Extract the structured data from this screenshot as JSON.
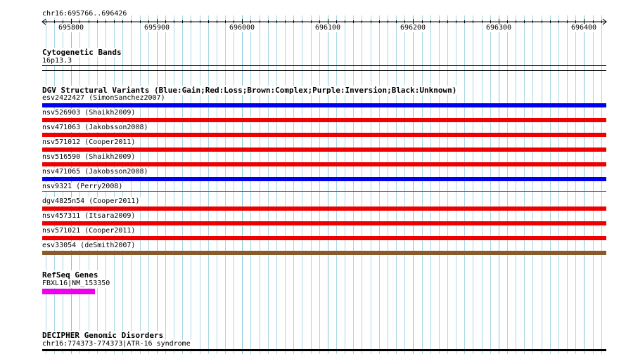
{
  "ruler": {
    "title": "chr16:695766..696426",
    "start": 695766,
    "end": 696426,
    "ticks": [
      {
        "value": 695800,
        "label": "695800"
      },
      {
        "value": 695900,
        "label": "695900"
      },
      {
        "value": 696000,
        "label": "696000"
      },
      {
        "value": 696100,
        "label": "696100"
      },
      {
        "value": 696200,
        "label": "696200"
      },
      {
        "value": 696300,
        "label": "696300"
      },
      {
        "value": 696400,
        "label": "696400"
      }
    ]
  },
  "cytobands": {
    "title": "Cytogenetic Bands",
    "band": "16p13.3"
  },
  "dgv": {
    "title": "DGV Structural Variants (Blue:Gain;Red:Loss;Brown:Complex;Purple:Inversion;Black:Unknown)",
    "variants": [
      {
        "label": "esv2422427 (SimonSanchez2007)",
        "type": "gain",
        "color": "#0000ee"
      },
      {
        "label": "nsv526903 (Shaikh2009)",
        "type": "loss",
        "color": "#ee0000"
      },
      {
        "label": "nsv471063 (Jakobsson2008)",
        "type": "loss",
        "color": "#ee0000"
      },
      {
        "label": "nsv571012 (Cooper2011)",
        "type": "loss",
        "color": "#ee0000"
      },
      {
        "label": "nsv516590 (Shaikh2009)",
        "type": "loss",
        "color": "#ee0000"
      },
      {
        "label": "nsv471065 (Jakobsson2008)",
        "type": "gain",
        "color": "#0000ee"
      },
      {
        "label": "nsv9321 (Perry2008)",
        "type": "complex",
        "color": "#8b5a2b"
      },
      {
        "label": "dgv4825n54 (Cooper2011)",
        "type": "loss",
        "color": "#ee0000"
      },
      {
        "label": "nsv457311 (Itsara2009)",
        "type": "loss",
        "color": "#ee0000"
      },
      {
        "label": "nsv571021 (Cooper2011)",
        "type": "loss",
        "color": "#ee0000"
      },
      {
        "label": "esv33054 (deSmith2007)",
        "type": "complex",
        "color": "#8b5a2b"
      }
    ]
  },
  "refseq": {
    "title": "RefSeq Genes",
    "gene": {
      "label": "FBXL16|NM_153350",
      "color": "#ee00ee"
    }
  },
  "decipher": {
    "title": "DECIPHER Genomic Disorders",
    "item": "chr16:774373-774373|ATR-16 syndrome"
  }
}
